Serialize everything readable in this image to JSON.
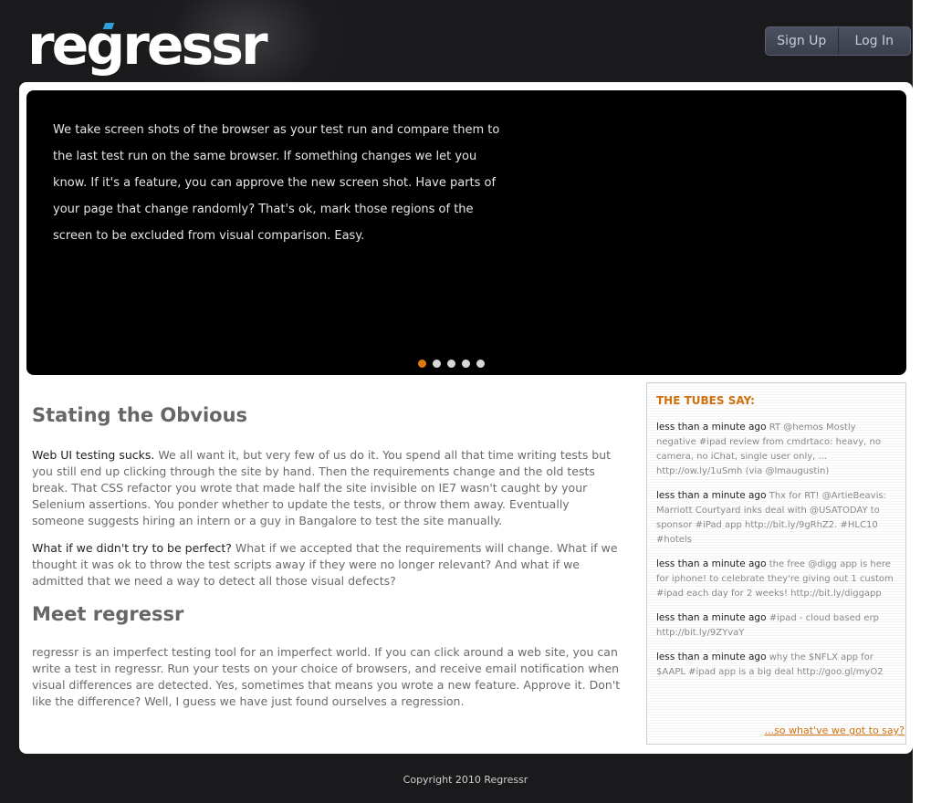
{
  "header": {
    "logo": "regressr",
    "signup_label": "Sign Up",
    "login_label": "Log In"
  },
  "hero": {
    "text": "We take screen shots of the browser as your test run and compare them to the last test run on the same browser. If something changes we let you know. If it's a feature, you can approve the new screen shot. Have parts of your page that change randomly? That's ok, mark those regions of the screen to be excluded from visual comparison. Easy.",
    "slides": 5,
    "active_slide": 1
  },
  "main": {
    "heading1": "Stating the Obvious",
    "p1_lead": "Web UI testing sucks.",
    "p1_body": " We all want it, but very few of us do it. You spend all that time writing tests but you still end up clicking through the site by hand. Then the requirements change and the old tests break. That CSS refactor you wrote that made half the site invisible on IE7 wasn't caught by your Selenium assertions. You ponder whether to update the tests, or throw them away. Eventually someone suggests hiring an intern or a guy in Bangalore to test the site manually.",
    "p2_lead": "What if we didn't try to be perfect?",
    "p2_body": " What if we accepted that the requirements will change. What if we thought it was ok to throw the test scripts away if they were no longer relevant? And what if we admitted that we need a way to detect all those visual defects?",
    "heading2": "Meet regressr",
    "p3": "regressr is an imperfect testing tool for an imperfect world. If you can click around a web site, you can write a test in regressr. Run your tests on your choice of browsers, and receive email notification when visual differences are detected. Yes, sometimes that means you wrote a new feature. Approve it. Don't like the difference? Well, I guess we have just found ourselves a regression."
  },
  "tubes": {
    "heading": "THE TUBES SAY:",
    "tweets": [
      {
        "when": "less than a minute ago",
        "text": "RT @hemos Mostly negative #ipad review from cmdrtaco: heavy, no camera, no iChat, single user only, ... http://ow.ly/1uSmh (via @lmaugustin)"
      },
      {
        "when": "less than a minute ago",
        "text": "Thx for RT! @ArtieBeavis: Marriott Courtyard inks deal with @USATODAY to sponsor #iPad app http://bit.ly/9gRhZ2. #HLC10 #hotels"
      },
      {
        "when": "less than a minute ago",
        "text": "the free @digg app is here for iphone! to celebrate they're giving out 1 custom #ipad each day for 2 weeks! http://bit.ly/diggapp"
      },
      {
        "when": "less than a minute ago",
        "text": "#ipad - cloud based erp http://bit.ly/9ZYvaY"
      },
      {
        "when": "less than a minute ago",
        "text": "why the $NFLX app for $AAPL #ipad app is a big deal http://goo.gl/myO2"
      }
    ],
    "more_link": "...so what've we got to say?"
  },
  "footer": {
    "copyright": "Copyright 2010 Regressr"
  },
  "colors": {
    "accent": "#e07a10",
    "page_bg": "#1a1a1c",
    "logo_dot": "#2d9fd9"
  }
}
